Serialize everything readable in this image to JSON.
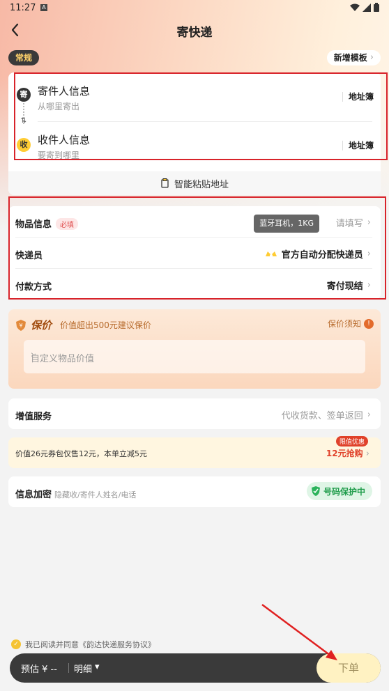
{
  "status_bar": {
    "time": "11:27",
    "notif_icon": "A"
  },
  "nav": {
    "title": "寄快递"
  },
  "template": {
    "chip": "常规",
    "new_button": "新增模板"
  },
  "sender": {
    "badge": "寄",
    "title": "寄件人信息",
    "subtitle": "从哪里寄出",
    "address_book": "地址簿"
  },
  "receiver": {
    "badge": "收",
    "title": "收件人信息",
    "subtitle": "要寄到哪里",
    "address_book": "地址簿"
  },
  "swap_icon": "⇅",
  "paste": {
    "label": "智能粘贴地址"
  },
  "item_info": {
    "label": "物品信息",
    "required": "必填",
    "tooltip": "蓝牙耳机，1KG",
    "value": "请填写"
  },
  "courier": {
    "label": "快递员",
    "value": "官方自动分配快递员"
  },
  "payment": {
    "label": "付款方式",
    "value": "寄付现结"
  },
  "insurance": {
    "title": "保价",
    "desc": "价值超出500元建议保价",
    "notice": "保价须知",
    "input_placeholder": "自定义物品价值"
  },
  "value_added": {
    "label": "增值服务",
    "value": "代收货款、签单返回"
  },
  "promo": {
    "text": "价值26元券包仅售12元，本单立减5元",
    "limit": "限值优惠",
    "action": "12元抢购"
  },
  "encryption": {
    "label": "信息加密",
    "sub": "隐藏收/寄件人姓名/电话",
    "badge": "号码保护中"
  },
  "agreement": {
    "text": "我已阅读并同意《韵达快递服务协议》"
  },
  "bottom": {
    "estimate": "预估 ¥ --",
    "detail": "明细",
    "order_button": "下单"
  },
  "colors": {
    "highlight": "#d8232a",
    "accent": "#ffcc33",
    "insurance": "#a14d10",
    "promo": "#e0422b",
    "protect": "#1e9c4a"
  }
}
